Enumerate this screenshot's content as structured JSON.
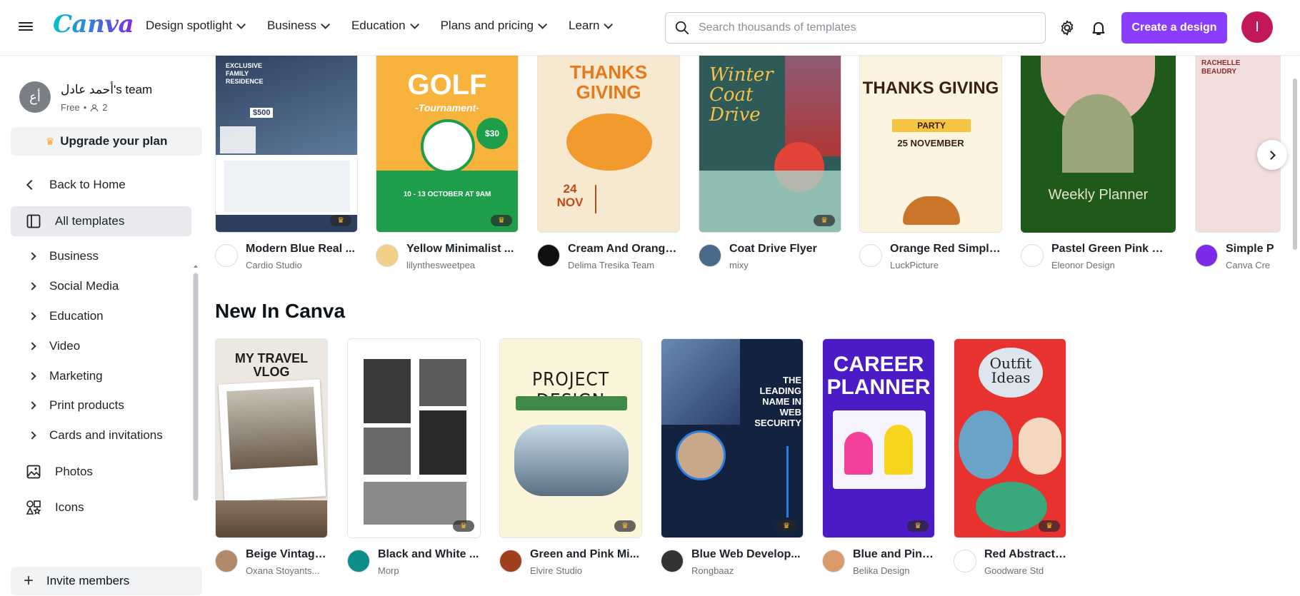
{
  "header": {
    "logo": "Canva",
    "nav": [
      {
        "label": "Design spotlight"
      },
      {
        "label": "Business"
      },
      {
        "label": "Education"
      },
      {
        "label": "Plans and pricing"
      },
      {
        "label": "Learn"
      }
    ],
    "search_placeholder": "Search thousands of templates",
    "create_label": "Create a design",
    "avatar_initial": "I"
  },
  "sidebar": {
    "team_initial": "أع",
    "team_name": "أحمد عادل's team",
    "plan": "Free",
    "members": "2",
    "upgrade_label": "Upgrade your plan",
    "back_label": "Back to Home",
    "all_templates": "All templates",
    "categories": [
      {
        "label": "Business"
      },
      {
        "label": "Social Media"
      },
      {
        "label": "Education"
      },
      {
        "label": "Video"
      },
      {
        "label": "Marketing"
      },
      {
        "label": "Print products"
      },
      {
        "label": "Cards and invitations"
      }
    ],
    "photos_label": "Photos",
    "icons_label": "Icons",
    "invite_label": "Invite members"
  },
  "row1": [
    {
      "title": "Modern Blue Real ...",
      "creator": "Cardio Studio",
      "thumb_text": "EXCLUSIVE FAMILY RESIDENCE",
      "price": "$500",
      "color": "#3a4a6b"
    },
    {
      "title": "Yellow Minimalist ...",
      "creator": "lilynthesweetpea",
      "thumb_text": "GOLF",
      "sub_text": "-Tournament-",
      "date_text": "10 - 13 OCTOBER AT 9AM",
      "price": "$30",
      "color": "#1e9e4a"
    },
    {
      "title": "Cream And Orange...",
      "creator": "Delima Tresika Team",
      "thumb_text": "THANKS GIVING",
      "date_text": "24 NOV",
      "color": "#f7e8d0"
    },
    {
      "title": "Coat Drive Flyer",
      "creator": "mixy",
      "thumb_text": "Winter Coat Drive",
      "color": "#2e5a58"
    },
    {
      "title": "Orange Red Simple...",
      "creator": "LuckPicture",
      "thumb_text": "THANKS GIVING",
      "sub_text": "PARTY",
      "date_text": "25 NOVEMBER",
      "color": "#fdf3e1"
    },
    {
      "title": "Pastel Green Pink We...",
      "creator": "Eleonor Design",
      "thumb_text": "Weekly Planner",
      "color": "#1f5a1a"
    },
    {
      "title": "Simple P",
      "creator": "Canva Cre",
      "thumb_text": "RACHELLE BEAUDRY",
      "color": "#f3dede"
    }
  ],
  "section_title": "New In Canva",
  "row2": [
    {
      "title": "Beige Vintage...",
      "creator": "Oxana Stoyants...",
      "thumb_text": "MY TRAVEL VLOG",
      "color": "#ece7df"
    },
    {
      "title": "Black and White ...",
      "creator": "Morp",
      "color": "#ffffff"
    },
    {
      "title": "Green and Pink Mi...",
      "creator": "Elvire Studio",
      "thumb_text": "PROJECT DESIGN",
      "color": "#fbf6d9"
    },
    {
      "title": "Blue Web Develop...",
      "creator": "Rongbaaz",
      "thumb_text": "THE LEADING NAME IN WEB SECURITY",
      "color": "#13223f"
    },
    {
      "title": "Blue and Pink...",
      "creator": "Belika Design",
      "thumb_text": "CAREER PLANNER",
      "color": "#4b1cc6"
    },
    {
      "title": "Red Abstract ...",
      "creator": "Goodware Std",
      "thumb_text": "Outfit Ideas",
      "color": "#e8322f"
    }
  ],
  "colors": {
    "accent": "#8b3dff",
    "avatar": "#c2185b"
  }
}
